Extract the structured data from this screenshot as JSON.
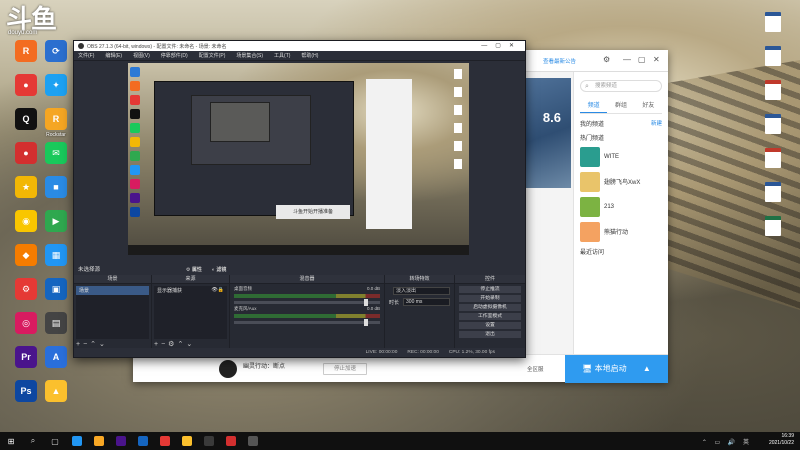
{
  "desktop": {
    "logo": "斗鱼",
    "logo_sub": "douyu.com",
    "left_icons": [
      {
        "label": "",
        "color": "#2d7ad6",
        "glyph": "D"
      },
      {
        "label": "",
        "color": "#1fa3e8",
        "glyph": "✈"
      },
      {
        "label": "",
        "color": "#f36c21",
        "glyph": "R"
      },
      {
        "label": "",
        "color": "#2b6fcf",
        "glyph": "⟳"
      },
      {
        "label": "",
        "color": "#e53935",
        "glyph": "●"
      },
      {
        "label": "",
        "color": "#1da1f2",
        "glyph": "✦"
      },
      {
        "label": "",
        "color": "#111111",
        "glyph": "Q"
      },
      {
        "label": "Rockstar",
        "color": "#f5a623",
        "glyph": "R"
      },
      {
        "label": "",
        "color": "#d32f2f",
        "glyph": "●"
      },
      {
        "label": "",
        "color": "#19c95b",
        "glyph": "✉"
      },
      {
        "label": "",
        "color": "#f2b705",
        "glyph": "★"
      },
      {
        "label": "",
        "color": "#2a8be5",
        "glyph": "■"
      },
      {
        "label": "",
        "color": "#f9c600",
        "glyph": "◉"
      },
      {
        "label": "",
        "color": "#2fa84f",
        "glyph": "▶"
      },
      {
        "label": "",
        "color": "#f57c00",
        "glyph": "◆"
      },
      {
        "label": "",
        "color": "#2196f3",
        "glyph": "▦"
      },
      {
        "label": "",
        "color": "#e53935",
        "glyph": "⚙"
      },
      {
        "label": "",
        "color": "#1565c0",
        "glyph": "▣"
      },
      {
        "label": "",
        "color": "#d81b60",
        "glyph": "◎"
      },
      {
        "label": "",
        "color": "#444444",
        "glyph": "▤"
      },
      {
        "label": "",
        "color": "#4a148c",
        "glyph": "Pr"
      },
      {
        "label": "",
        "color": "#2a6fdb",
        "glyph": "A"
      },
      {
        "label": "",
        "color": "#0d47a1",
        "glyph": "Ps"
      },
      {
        "label": "",
        "color": "#fbc02d",
        "glyph": "▲"
      }
    ],
    "right_files": [
      {
        "label": "",
        "kind": "doc"
      },
      {
        "label": "",
        "kind": "doc"
      },
      {
        "label": "",
        "kind": "pdf"
      },
      {
        "label": "",
        "kind": "doc"
      },
      {
        "label": "",
        "kind": "pdf"
      },
      {
        "label": "",
        "kind": "doc"
      },
      {
        "label": "",
        "kind": "xls"
      }
    ]
  },
  "launcher": {
    "notice": "查看最新公告",
    "version_badge": "8.6",
    "search_placeholder": "搜索频道",
    "tabs": [
      "频道",
      "群组",
      "好友"
    ],
    "my_channels": "我的频道",
    "create_label": "新建",
    "hot_channels": "热门频道",
    "rooms": [
      {
        "name": "WITE",
        "meta": "",
        "color": "#2a9d8f"
      },
      {
        "name": "翅膀飞鸟XwX",
        "meta": "",
        "color": "#e9c46a"
      },
      {
        "name": "213",
        "meta": "",
        "color": "#7cb342"
      },
      {
        "name": "熊猫行动",
        "meta": "",
        "color": "#f4a261"
      }
    ],
    "recent": "最近访问",
    "stream_title": "幽灵行动：断点",
    "stream_sub": "",
    "stop_label": "停止加速",
    "mode_select": "全区服",
    "start_label": "本地启动"
  },
  "obs": {
    "title": "OBS 27.1.3 (64-bit, windows) - 配置文件: 未命名 - 场景: 未命名",
    "menus": [
      "文件(F)",
      "编辑(E)",
      "视图(V)",
      "停靠部件(D)",
      "配置文件(P)",
      "场景集合(S)",
      "工具(T)",
      "帮助(H)"
    ],
    "nested_caption": "斗鱼开始开播准备",
    "scene_name": "未选择源",
    "audio_props": "属性",
    "audio_filters": "滤镜",
    "docks": {
      "scenes": "场景",
      "sources": "来源",
      "mixer": "混音器",
      "transitions": "转场特效",
      "controls": "控件"
    },
    "scene_item": "场景",
    "source_item": "显示器捕获",
    "mixer_channels": [
      {
        "name": "桌面音频",
        "level": "0.0 dB"
      },
      {
        "name": "麦克风/Aux",
        "level": "0.0 dB"
      }
    ],
    "transition_label": "淡入淡出",
    "duration_label": "时长",
    "duration_value": "300 ms",
    "control_buttons": [
      "停止推流",
      "开始录制",
      "启动虚拟摄像机",
      "工作室模式",
      "设置",
      "退出"
    ],
    "status": {
      "live": "LIVE: 00:00:00",
      "rec": "REC: 00:00:00",
      "cpu": "CPU: 1.2%, 30.00 fps"
    }
  },
  "taskbar": {
    "time": "16:39",
    "date": "2021/10/22",
    "items": [
      {
        "glyph": "⊞",
        "color": "#ffffff"
      },
      {
        "glyph": "⌕",
        "color": "#dddddd"
      },
      {
        "glyph": "▢",
        "color": "#dddddd"
      },
      {
        "glyph": "",
        "color": "#2196f3"
      },
      {
        "glyph": "",
        "color": "#f9a825"
      },
      {
        "glyph": "",
        "color": "#4a148c"
      },
      {
        "glyph": "",
        "color": "#1565c0"
      },
      {
        "glyph": "",
        "color": "#e53935"
      },
      {
        "glyph": "",
        "color": "#fbc02d"
      },
      {
        "glyph": "",
        "color": "#3a3a3a"
      },
      {
        "glyph": "",
        "color": "#d32f2f"
      },
      {
        "glyph": "",
        "color": "#555555"
      }
    ]
  },
  "colors": {
    "obs_bg": "#2b2e38",
    "accent_blue": "#2f9bf0"
  }
}
